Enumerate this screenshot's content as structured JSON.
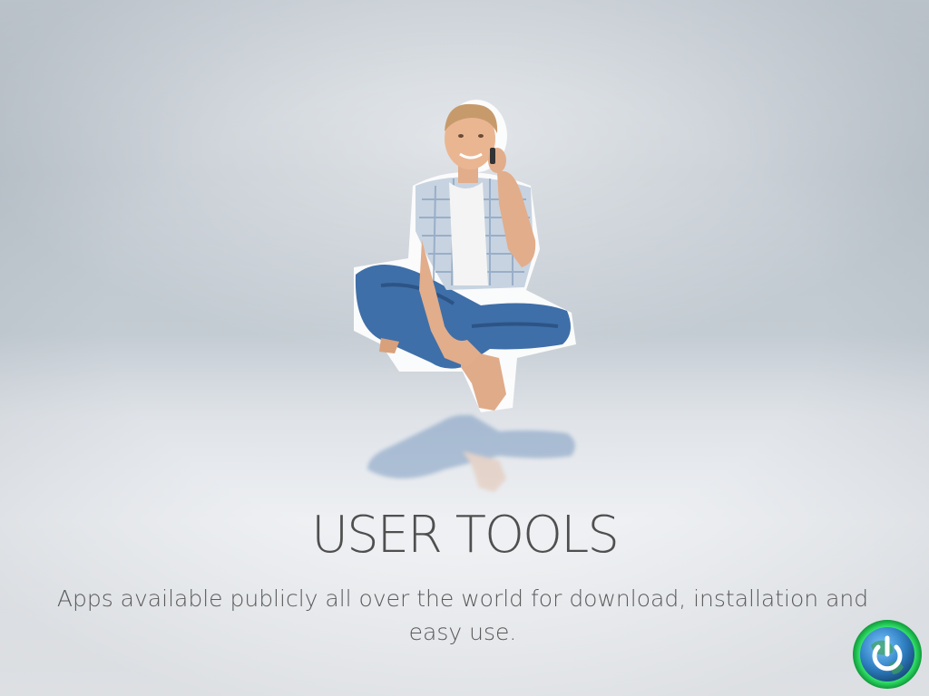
{
  "slide": {
    "title": "USER TOOLS",
    "subtitle": "Apps available publicly all over the world for download, installation and easy use."
  },
  "figure": {
    "description_icon": "person-sitting-on-phone-icon"
  },
  "logo": {
    "icon": "power-globe-icon",
    "colors": {
      "ring": "#33e26a",
      "globe": "#2f7fc2",
      "symbol": "#ffffff"
    }
  },
  "colors": {
    "title_text": "#4f4f4f",
    "subtitle_text": "#5a5a5a",
    "background_top": "#c9d0d7",
    "background_bottom": "#f3f4f6"
  }
}
